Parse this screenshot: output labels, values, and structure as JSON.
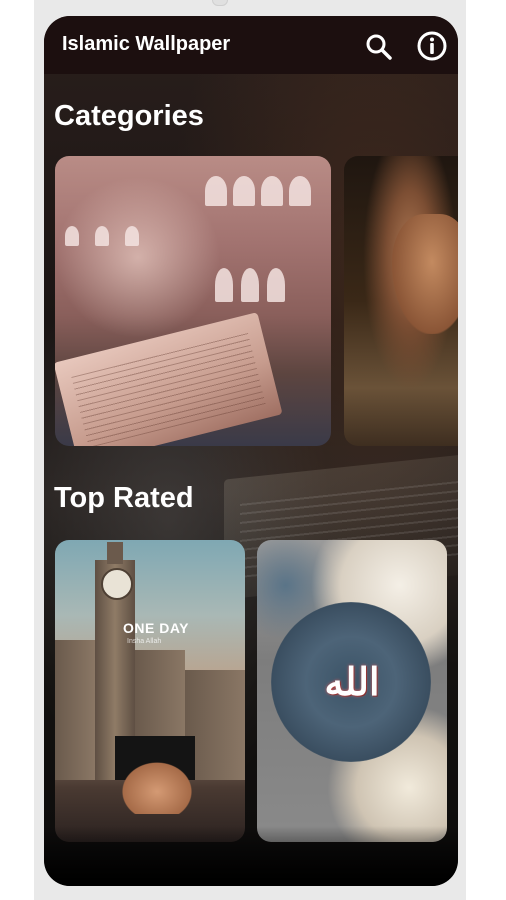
{
  "app": {
    "title": "Islamic Wallpaper"
  },
  "toolbar": {
    "search_icon": "search-icon",
    "info_icon": "info-icon"
  },
  "sections": {
    "categories_title": "Categories",
    "top_rated_title": "Top Rated"
  },
  "top_rated": {
    "card1_caption": "ONE DAY",
    "card1_subcaption": "Insha Allah"
  },
  "colors": {
    "appbar": "#1c0f0f",
    "text": "#ffffff",
    "background": "#1a1514"
  }
}
